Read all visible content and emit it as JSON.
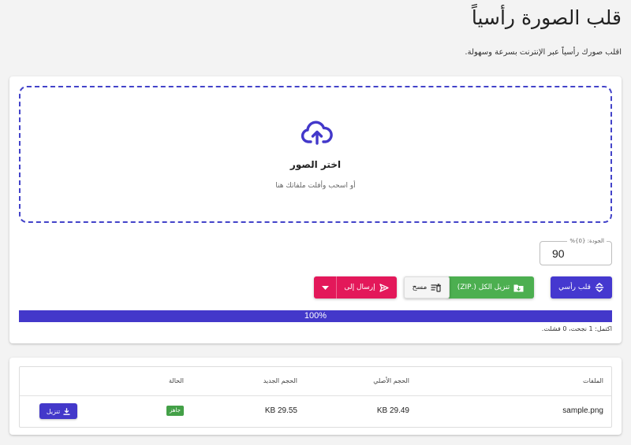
{
  "page": {
    "title": "قلب الصورة رأسياً",
    "subtitle": "اقلب صورك رأسياً عبر الإنترنت بسرعة وسهولة."
  },
  "dropzone": {
    "title": "اختر الصور",
    "hint": "أو اسحب وأفلت ملفاتك هنا",
    "icon": "cloud-upload-icon"
  },
  "angle": {
    "label": "الجودة: {0}%",
    "value": "90"
  },
  "actions": {
    "flip_label": "قلب رأسي",
    "zip_label": "تنزيل الكل (.ZIP)",
    "clear_label": "مسح",
    "send_label": "إرسال إلى"
  },
  "progress": {
    "value": 1.0,
    "label": "100%"
  },
  "status_line": "اكتمل: 1 نجحت، 0 فشلت.",
  "table": {
    "headers": {
      "files": "الملفات",
      "original_size": "الحجم الأصلي",
      "new_size": "الحجم الجديد",
      "status": "الحالة"
    },
    "rows": [
      {
        "file": "sample.png",
        "original_size": "29.49 KB",
        "new_size": "29.55 KB",
        "status": "جاهز",
        "download_label": "تنزيل"
      }
    ]
  },
  "colors": {
    "primary": "#4338ca",
    "success": "#4caf50",
    "accent": "#e3185a",
    "background": "#f3f3f3"
  }
}
